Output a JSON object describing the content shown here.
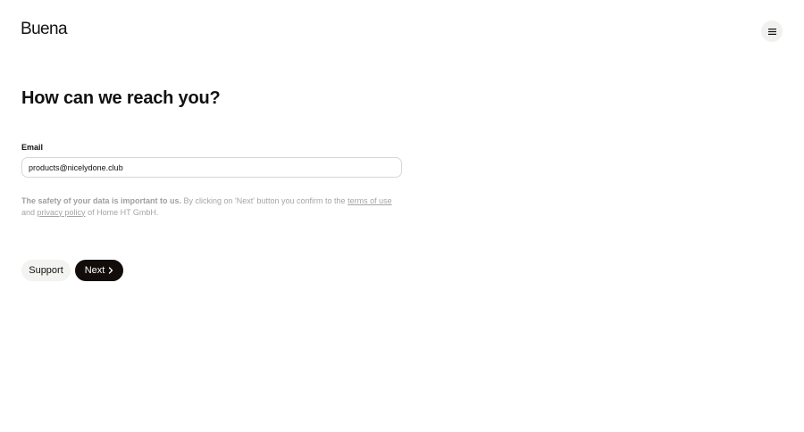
{
  "header": {
    "logo_text": "Buena",
    "menu_icon": "hamburger-menu-icon"
  },
  "main": {
    "title": "How can we reach you?",
    "email": {
      "label": "Email",
      "value": "products@nicelydone.club"
    },
    "disclaimer": {
      "bold_text": "The safety of your data is important to us.",
      "text_1": " By clicking on 'Next' button you confirm to the ",
      "terms_link": "terms of use",
      "text_2": " and ",
      "privacy_link": "privacy policy",
      "text_3": " of Home HT GmbH."
    }
  },
  "actions": {
    "support_label": "Support",
    "next_label": "Next",
    "next_icon": "chevron-right-icon"
  },
  "colors": {
    "primary_button": "#120c0a",
    "secondary_button": "#f3f3f1",
    "muted_text": "#a5a5a3"
  }
}
